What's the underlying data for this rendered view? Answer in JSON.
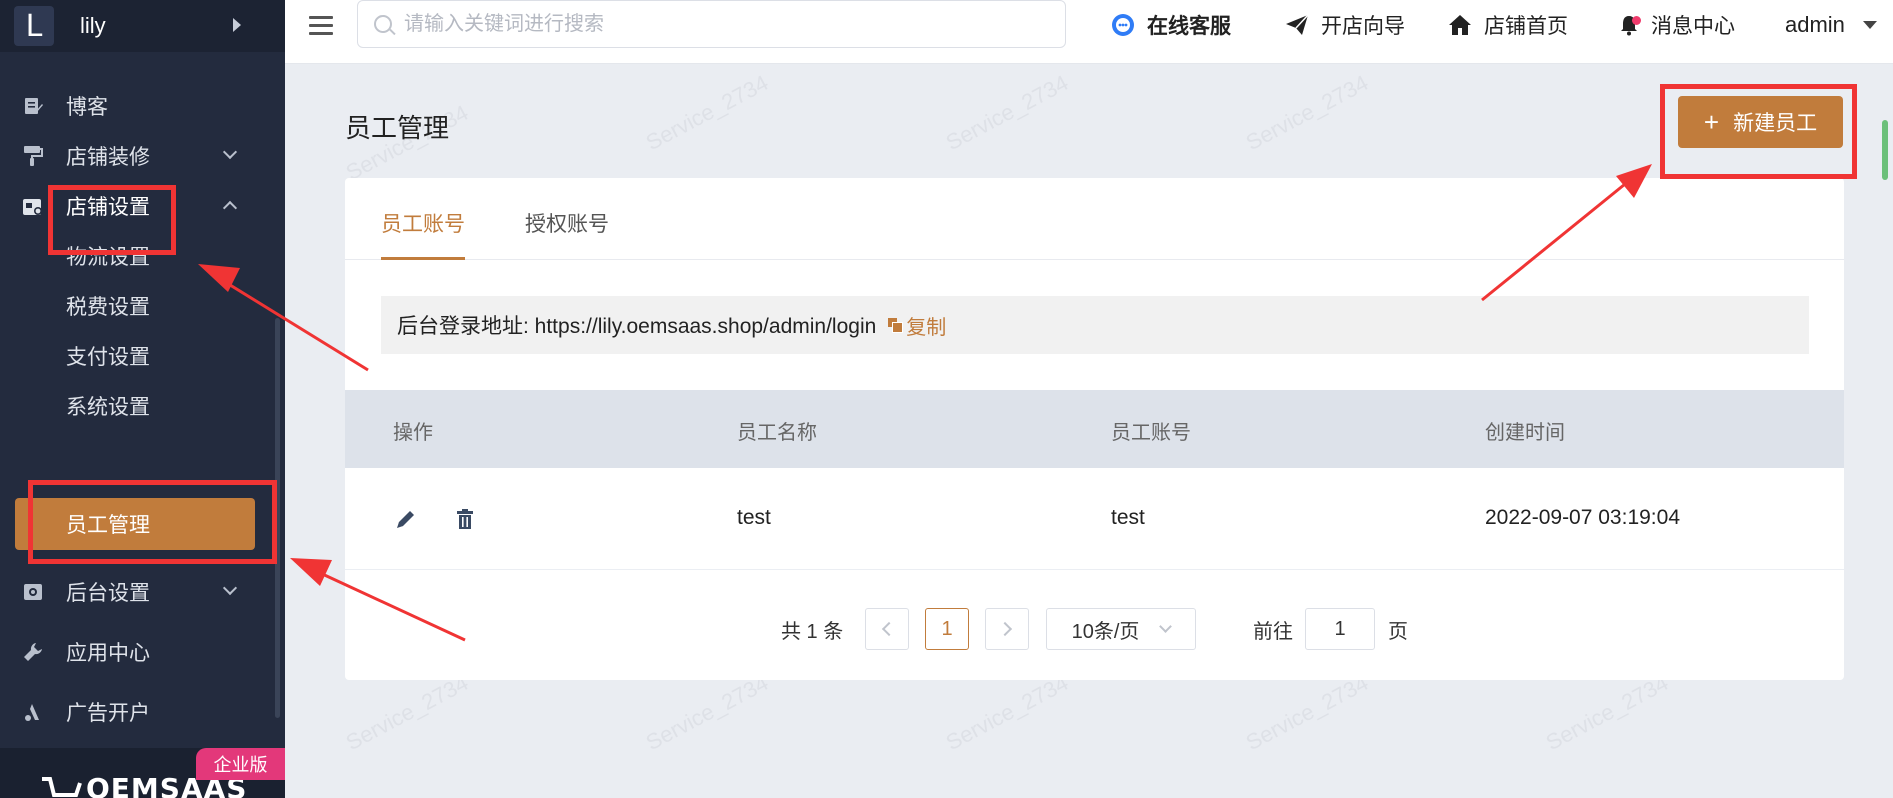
{
  "brand": {
    "logo_letter": "L",
    "name": "lily"
  },
  "sidebar": {
    "items": [
      {
        "label": "博客",
        "icon": "edit-icon"
      },
      {
        "label": "店铺装修",
        "icon": "paint-roller-icon"
      },
      {
        "label": "店铺设置",
        "icon": "store-settings-icon"
      },
      {
        "label": "物流设置"
      },
      {
        "label": "税费设置"
      },
      {
        "label": "支付设置"
      },
      {
        "label": "系统设置"
      },
      {
        "label": "员工管理"
      },
      {
        "label": "后台设置",
        "icon": "gear-icon"
      },
      {
        "label": "应用中心",
        "icon": "wrench-icon"
      },
      {
        "label": "广告开户",
        "icon": "ads-icon"
      }
    ],
    "badge": "企业版",
    "footer_brand": "OEMSAAS"
  },
  "header": {
    "search_placeholder": "请输入关键词进行搜索",
    "links": {
      "service": "在线客服",
      "guide": "开店向导",
      "home": "店铺首页",
      "messages": "消息中心"
    },
    "user": "admin"
  },
  "main": {
    "title": "员工管理",
    "new_button": "新建员工",
    "tabs": [
      "员工账号",
      "授权账号"
    ],
    "login_label": "后台登录地址: https://lily.oemsaas.shop/admin/login",
    "copy_label": "复制",
    "table": {
      "columns": [
        "操作",
        "员工名称",
        "员工账号",
        "创建时间"
      ],
      "rows": [
        {
          "name": "test",
          "account": "test",
          "created": "2022-09-07 03:19:04"
        }
      ]
    },
    "pagination": {
      "total": "共 1 条",
      "current_page": "1",
      "page_size": "10条/页",
      "goto_label": "前往",
      "goto_value": "1",
      "page_suffix": "页"
    }
  },
  "watermark": "Service_2734",
  "colors": {
    "accent": "#c17c3c",
    "sidebar_bg": "#232b3e",
    "annotation": "#f03434",
    "badge": "#e3387a"
  }
}
